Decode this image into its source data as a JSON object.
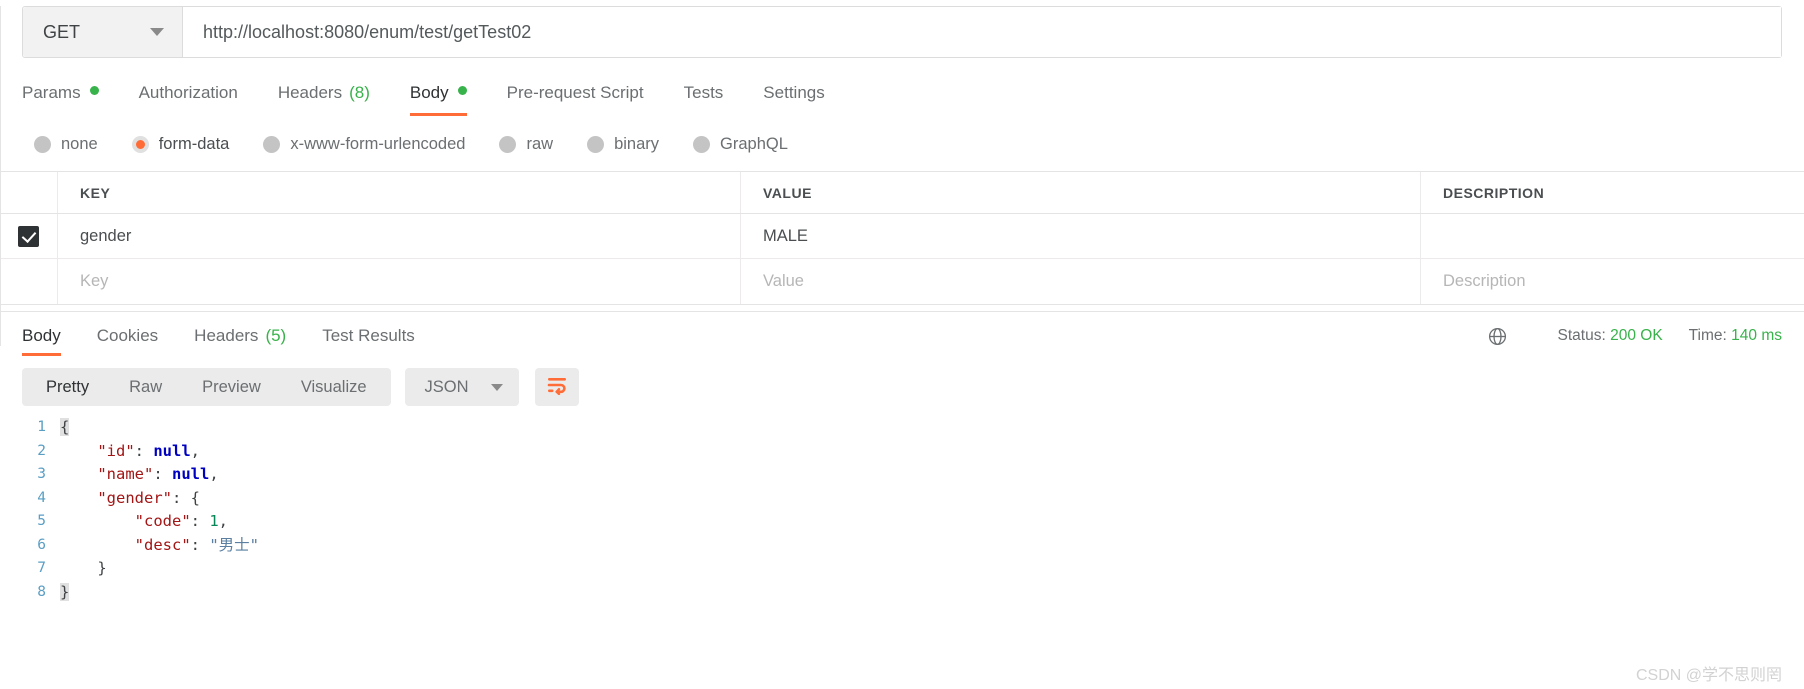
{
  "request": {
    "method": "GET",
    "url": "http://localhost:8080/enum/test/getTest02",
    "tabs": [
      {
        "label": "Params",
        "dot": true,
        "count": "",
        "active": false
      },
      {
        "label": "Authorization",
        "dot": false,
        "count": "",
        "active": false
      },
      {
        "label": "Headers",
        "dot": false,
        "count": "(8)",
        "active": false
      },
      {
        "label": "Body",
        "dot": true,
        "count": "",
        "active": true
      },
      {
        "label": "Pre-request Script",
        "dot": false,
        "count": "",
        "active": false
      },
      {
        "label": "Tests",
        "dot": false,
        "count": "",
        "active": false
      },
      {
        "label": "Settings",
        "dot": false,
        "count": "",
        "active": false
      }
    ],
    "body_types": [
      {
        "label": "none",
        "checked": false
      },
      {
        "label": "form-data",
        "checked": true
      },
      {
        "label": "x-www-form-urlencoded",
        "checked": false
      },
      {
        "label": "raw",
        "checked": false
      },
      {
        "label": "binary",
        "checked": false
      },
      {
        "label": "GraphQL",
        "checked": false
      }
    ],
    "table": {
      "headers": {
        "key": "KEY",
        "value": "VALUE",
        "description": "DESCRIPTION"
      },
      "rows": [
        {
          "checked": true,
          "key": "gender",
          "value": "MALE",
          "description": ""
        }
      ],
      "placeholder": {
        "key": "Key",
        "value": "Value",
        "description": "Description"
      }
    }
  },
  "response": {
    "tabs": [
      {
        "label": "Body",
        "count": "",
        "active": true
      },
      {
        "label": "Cookies",
        "count": "",
        "active": false
      },
      {
        "label": "Headers",
        "count": "(5)",
        "active": false
      },
      {
        "label": "Test Results",
        "count": "",
        "active": false
      }
    ],
    "status_label": "Status:",
    "status_value": "200 OK",
    "time_label": "Time:",
    "time_value": "140 ms",
    "globe_icon": "globe-icon",
    "format_buttons": [
      {
        "label": "Pretty",
        "active": true
      },
      {
        "label": "Raw",
        "active": false
      },
      {
        "label": "Preview",
        "active": false
      },
      {
        "label": "Visualize",
        "active": false
      }
    ],
    "format_select": "JSON",
    "wrap_icon": "word-wrap-icon",
    "code_lines": [
      {
        "n": "1",
        "tokens": [
          {
            "t": "{",
            "c": "tk-brace-hl"
          }
        ]
      },
      {
        "n": "2",
        "tokens": [
          {
            "t": "    ",
            "c": "tk-punct"
          },
          {
            "t": "\"id\"",
            "c": "tk-key"
          },
          {
            "t": ": ",
            "c": "tk-punct"
          },
          {
            "t": "null",
            "c": "tk-null"
          },
          {
            "t": ",",
            "c": "tk-punct"
          }
        ]
      },
      {
        "n": "3",
        "tokens": [
          {
            "t": "    ",
            "c": "tk-punct"
          },
          {
            "t": "\"name\"",
            "c": "tk-key"
          },
          {
            "t": ": ",
            "c": "tk-punct"
          },
          {
            "t": "null",
            "c": "tk-null"
          },
          {
            "t": ",",
            "c": "tk-punct"
          }
        ]
      },
      {
        "n": "4",
        "tokens": [
          {
            "t": "    ",
            "c": "tk-punct"
          },
          {
            "t": "\"gender\"",
            "c": "tk-key"
          },
          {
            "t": ": {",
            "c": "tk-punct"
          }
        ]
      },
      {
        "n": "5",
        "tokens": [
          {
            "t": "        ",
            "c": "tk-punct"
          },
          {
            "t": "\"code\"",
            "c": "tk-key"
          },
          {
            "t": ": ",
            "c": "tk-punct"
          },
          {
            "t": "1",
            "c": "tk-num"
          },
          {
            "t": ",",
            "c": "tk-punct"
          }
        ]
      },
      {
        "n": "6",
        "tokens": [
          {
            "t": "        ",
            "c": "tk-punct"
          },
          {
            "t": "\"desc\"",
            "c": "tk-key"
          },
          {
            "t": ": ",
            "c": "tk-punct"
          },
          {
            "t": "\"男士\"",
            "c": "tk-str"
          }
        ]
      },
      {
        "n": "7",
        "tokens": [
          {
            "t": "    }",
            "c": "tk-punct"
          }
        ]
      },
      {
        "n": "8",
        "tokens": [
          {
            "t": "}",
            "c": "tk-brace-hl"
          }
        ]
      }
    ]
  },
  "watermark": "CSDN @学不思则罔",
  "colors": {
    "accent": "#ff6c37",
    "green": "#38b24a",
    "text": "#3f4345"
  }
}
